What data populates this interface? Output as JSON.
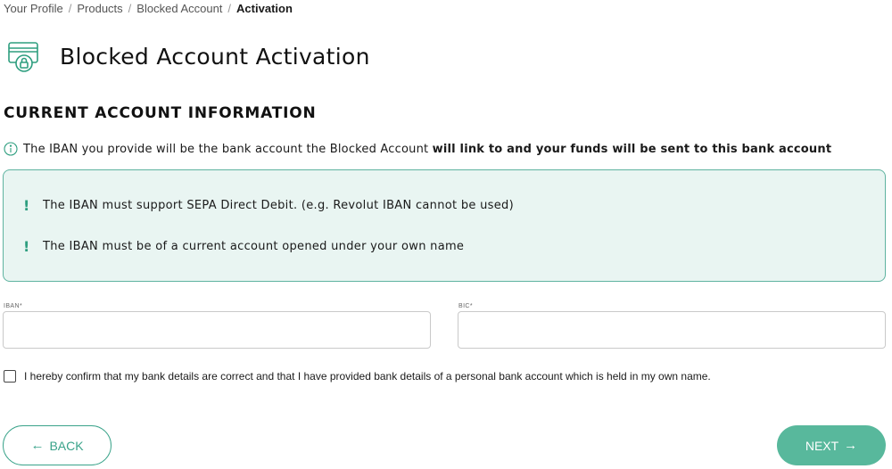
{
  "breadcrumb": {
    "items": [
      "Your Profile",
      "Products",
      "Blocked Account"
    ],
    "current": "Activation",
    "separator": "/"
  },
  "header": {
    "title": "Blocked Account Activation",
    "icon": "card-lock-icon"
  },
  "section": {
    "title": "CURRENT ACCOUNT INFORMATION"
  },
  "info": {
    "icon": "info-icon",
    "text_plain": "The IBAN you provide will be the bank account the Blocked Account ",
    "text_bold": "will link to and your funds will be sent to this bank account"
  },
  "notices": {
    "marker": "!",
    "items": [
      "The IBAN must support SEPA Direct Debit. (e.g. Revolut IBAN cannot be used)",
      "The IBAN must be of a current account opened under your own name"
    ]
  },
  "form": {
    "iban_label": "IBAN*",
    "iban_value": "",
    "bic_label": "BIC*",
    "bic_value": "",
    "confirm_label": "I hereby confirm that my bank details are correct and that I have provided bank details of a personal bank account which is held in my own name.",
    "confirm_checked": false
  },
  "actions": {
    "back_label": "BACK",
    "back_arrow": "←",
    "next_label": "NEXT",
    "next_arrow": "→"
  },
  "colors": {
    "accent": "#58b89c",
    "accent_border": "#3aa38a",
    "notice_bg": "#e9f5f2",
    "notice_marker": "#2e9e7f"
  }
}
